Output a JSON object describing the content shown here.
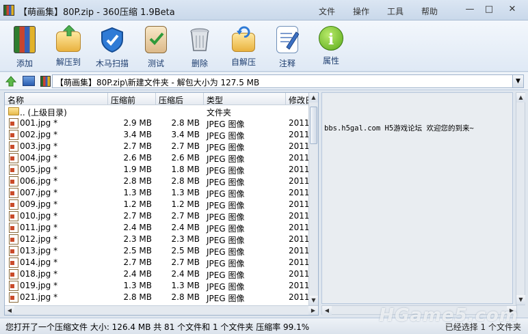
{
  "window": {
    "title": "【萌画集】80P.zip - 360压缩 1.9Beta",
    "menus": [
      "文件",
      "操作",
      "工具",
      "帮助"
    ],
    "controls": [
      "—",
      "□",
      "✕"
    ]
  },
  "toolbar": {
    "buttons": [
      {
        "label": "添加",
        "icon": "add-archive-icon"
      },
      {
        "label": "解压到",
        "icon": "extract-to-icon"
      },
      {
        "label": "木马扫描",
        "icon": "trojan-scan-shield-icon"
      },
      {
        "label": "测试",
        "icon": "test-checklist-icon"
      },
      {
        "label": "删除",
        "icon": "trash-can-icon"
      },
      {
        "label": "自解压",
        "icon": "self-extract-icon"
      },
      {
        "label": "注释",
        "icon": "comment-edit-icon"
      },
      {
        "label": "属性",
        "icon": "info-icon"
      }
    ]
  },
  "address": {
    "path": "【萌画集】80P.zip\\新建文件夹 - 解包大小为 127.5 MB"
  },
  "file_list": {
    "columns": [
      "名称",
      "压缩前",
      "压缩后",
      "类型",
      "修改日"
    ],
    "parent_row": {
      "name": ".. (上级目录)",
      "type": "文件夹"
    },
    "rows": [
      {
        "name": "001.jpg *",
        "before": "2.9 MB",
        "after": "2.8 MB",
        "type": "JPEG 图像",
        "modified": "2011"
      },
      {
        "name": "002.jpg *",
        "before": "3.4 MB",
        "after": "3.4 MB",
        "type": "JPEG 图像",
        "modified": "2011"
      },
      {
        "name": "003.jpg *",
        "before": "2.7 MB",
        "after": "2.7 MB",
        "type": "JPEG 图像",
        "modified": "2011"
      },
      {
        "name": "004.jpg *",
        "before": "2.6 MB",
        "after": "2.6 MB",
        "type": "JPEG 图像",
        "modified": "2011"
      },
      {
        "name": "005.jpg *",
        "before": "1.9 MB",
        "after": "1.8 MB",
        "type": "JPEG 图像",
        "modified": "2011"
      },
      {
        "name": "006.jpg *",
        "before": "2.8 MB",
        "after": "2.8 MB",
        "type": "JPEG 图像",
        "modified": "2011"
      },
      {
        "name": "007.jpg *",
        "before": "1.3 MB",
        "after": "1.3 MB",
        "type": "JPEG 图像",
        "modified": "2011"
      },
      {
        "name": "009.jpg *",
        "before": "1.2 MB",
        "after": "1.2 MB",
        "type": "JPEG 图像",
        "modified": "2011"
      },
      {
        "name": "010.jpg *",
        "before": "2.7 MB",
        "after": "2.7 MB",
        "type": "JPEG 图像",
        "modified": "2011"
      },
      {
        "name": "011.jpg *",
        "before": "2.4 MB",
        "after": "2.4 MB",
        "type": "JPEG 图像",
        "modified": "2011"
      },
      {
        "name": "012.jpg *",
        "before": "2.3 MB",
        "after": "2.3 MB",
        "type": "JPEG 图像",
        "modified": "2011"
      },
      {
        "name": "013.jpg *",
        "before": "2.5 MB",
        "after": "2.5 MB",
        "type": "JPEG 图像",
        "modified": "2011"
      },
      {
        "name": "014.jpg *",
        "before": "2.7 MB",
        "after": "2.7 MB",
        "type": "JPEG 图像",
        "modified": "2011"
      },
      {
        "name": "018.jpg *",
        "before": "2.4 MB",
        "after": "2.4 MB",
        "type": "JPEG 图像",
        "modified": "2011"
      },
      {
        "name": "019.jpg *",
        "before": "1.3 MB",
        "after": "1.3 MB",
        "type": "JPEG 图像",
        "modified": "2011"
      },
      {
        "name": "021.jpg *",
        "before": "2.8 MB",
        "after": "2.8 MB",
        "type": "JPEG 图像",
        "modified": "2011"
      }
    ]
  },
  "info_pane": {
    "comment": "bbs.h5gal.com H5游戏论坛 欢迎您的到来~"
  },
  "status": {
    "left": "您打开了一个压缩文件 大小: 126.4 MB 共 81 个文件和 1 个文件夹 压缩率 99.1%",
    "right": "已经选择 1 个文件夹"
  },
  "watermark": "HGame5.com"
}
